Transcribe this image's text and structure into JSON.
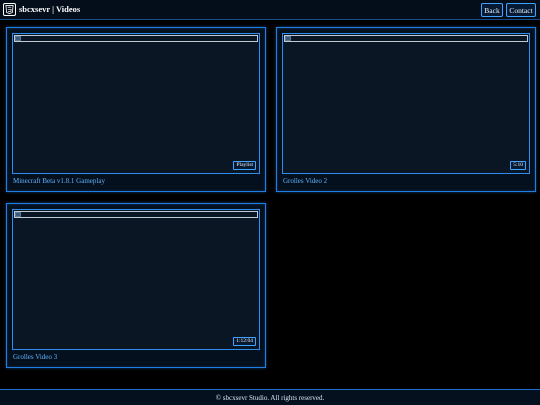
{
  "header": {
    "title": "sbcxsevr | Videos",
    "logo_icon": "html5-shield-icon",
    "nav": {
      "back_label": "Back",
      "contact_label": "Contact"
    }
  },
  "videos": [
    {
      "title": "Minecraft Beta v1.8.1 Gameplay",
      "duration": "Playlist",
      "thumbnail_icon": "broken-image-icon"
    },
    {
      "title": "Grolles Video 2",
      "duration": "5:10",
      "thumbnail_icon": "broken-image-icon"
    },
    {
      "title": "Grolles Video 3",
      "duration": "1:12:04",
      "thumbnail_icon": "broken-image-icon"
    }
  ],
  "footer": {
    "text": "© sbcxsevr Studio. All rights reserved."
  },
  "colors": {
    "accent": "#1f7fe0",
    "title_text": "#5fb4ff",
    "background": "#000000",
    "card_bg": "#04101e"
  }
}
